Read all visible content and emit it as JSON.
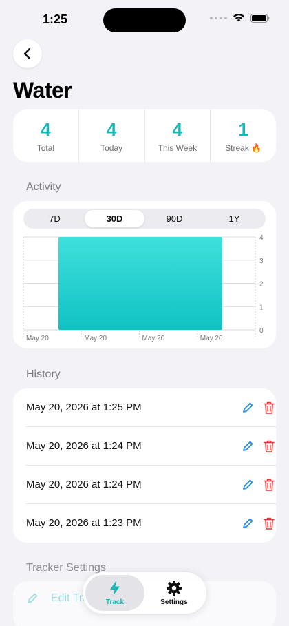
{
  "status": {
    "time": "1:25"
  },
  "header": {
    "title": "Water"
  },
  "stats": [
    {
      "value": "4",
      "label": "Total"
    },
    {
      "value": "4",
      "label": "Today"
    },
    {
      "value": "4",
      "label": "This Week"
    },
    {
      "value": "1",
      "label": "Streak 🔥"
    }
  ],
  "activity": {
    "header": "Activity",
    "ranges": [
      "7D",
      "30D",
      "90D",
      "1Y"
    ],
    "selected_range": "30D"
  },
  "chart_data": {
    "type": "bar",
    "categories": [
      "May 20"
    ],
    "values": [
      4
    ],
    "x_tick_labels": [
      "May 20",
      "May 20",
      "May 20",
      "May 20"
    ],
    "y_ticks": [
      0,
      1,
      2,
      3,
      4
    ],
    "ylim": [
      0,
      4
    ],
    "color": "#2fd1d1",
    "grid": true
  },
  "history": {
    "header": "History",
    "entries": [
      "May 20, 2026 at 1:25 PM",
      "May 20, 2026 at 1:24 PM",
      "May 20, 2026 at 1:24 PM",
      "May 20, 2026 at 1:23 PM"
    ]
  },
  "settings": {
    "header": "Tracker Settings",
    "edit_label": "Edit Tracker"
  },
  "tabbar": {
    "items": [
      {
        "label": "Track",
        "icon": "bolt-icon"
      },
      {
        "label": "Settings",
        "icon": "gear-icon"
      }
    ],
    "active": "Track"
  },
  "colors": {
    "accent": "#18b8b8",
    "delete": "#e53935",
    "edit": "#1e88e5"
  }
}
